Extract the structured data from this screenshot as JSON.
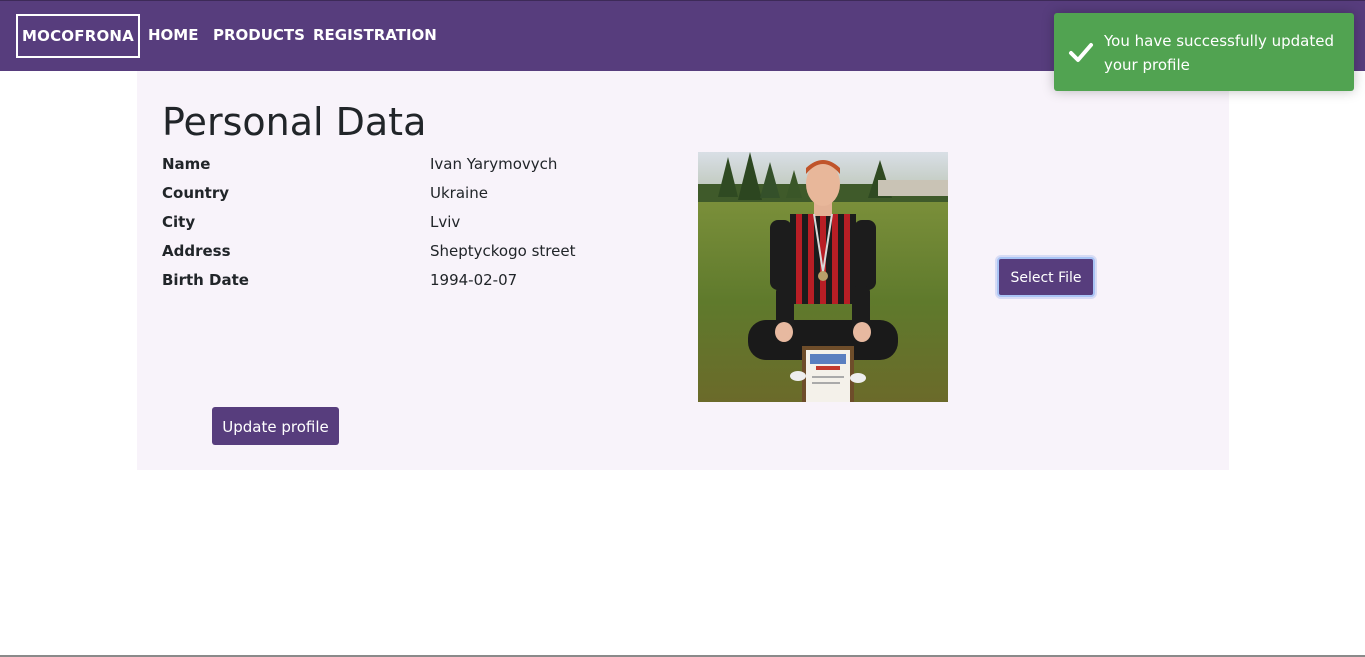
{
  "navbar": {
    "brand": "MOCOFRONA",
    "links": [
      "HOME",
      "PRODUCTS",
      "REGISTRATION"
    ],
    "color": "#573d7d"
  },
  "profile": {
    "title": "Personal Data",
    "fields": [
      {
        "label": "Name",
        "value": "Ivan Yarymovych"
      },
      {
        "label": "Country",
        "value": "Ukraine"
      },
      {
        "label": "City",
        "value": "Lviv"
      },
      {
        "label": "Address",
        "value": "Sheptyckogo street"
      },
      {
        "label": "Birth Date",
        "value": "1994-02-07"
      }
    ],
    "select_file_label": "Select File",
    "update_label": "Update profile",
    "photo_icon": "profile-photo"
  },
  "toast": {
    "message": "You have successfully updated your profile",
    "icon": "checkmark-icon",
    "color": "#51a351"
  }
}
